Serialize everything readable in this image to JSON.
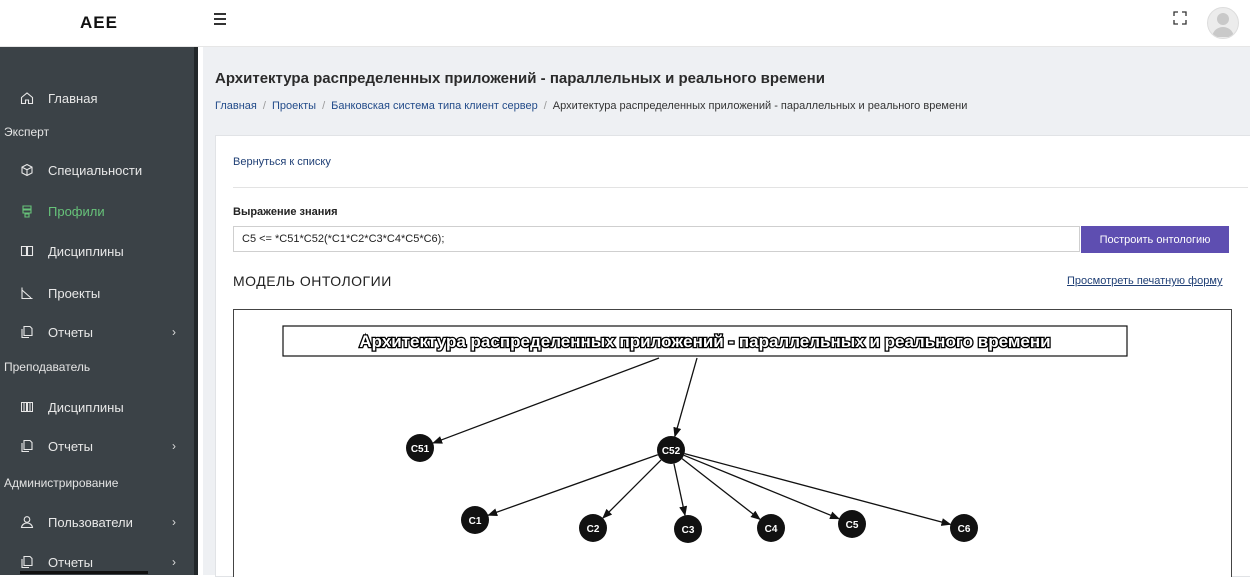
{
  "app": {
    "brand": "AEE"
  },
  "sidebar": {
    "items": [
      {
        "label": "Главная",
        "icon": "home-icon"
      },
      {
        "section": "Эксперт"
      },
      {
        "label": "Специальности",
        "icon": "cube-icon"
      },
      {
        "label": "Профили",
        "icon": "stack-icon",
        "active": true
      },
      {
        "label": "Дисциплины",
        "icon": "book-icon"
      },
      {
        "label": "Проекты",
        "icon": "chart-icon"
      },
      {
        "label": "Отчеты",
        "icon": "copy-icon",
        "chevron": "›"
      },
      {
        "section": "Преподаватель"
      },
      {
        "label": "Дисциплины",
        "icon": "book-icon"
      },
      {
        "label": "Отчеты",
        "icon": "copy-icon",
        "chevron": "›"
      },
      {
        "section": "Администрирование"
      },
      {
        "label": "Пользователи",
        "icon": "user-icon",
        "chevron": "›"
      },
      {
        "label": "Отчеты",
        "icon": "copy-icon",
        "chevron": "›"
      }
    ]
  },
  "page": {
    "title": "Архитектура распределенных приложений - параллельных и реального времени",
    "breadcrumb": [
      "Главная",
      "Проекты",
      "Банковская система типа клиент сервер",
      "Архитектура распределенных приложений - параллельных и реального времени"
    ]
  },
  "form": {
    "back_label": "Вернуться к списку",
    "expr_label": "Выражение знания",
    "expr_value": "C5 <= *C51*C52(*C1*C2*C3*C4*C5*C6);",
    "build_label": "Построить онтологию",
    "model_title": "МОДЕЛЬ ОНТОЛОГИИ",
    "print_label": "Просмотреть печатную форму"
  },
  "colors": {
    "accent": "#5e4eb1",
    "sidebar_bg": "#3b4247",
    "active": "#67c37a",
    "link": "#1f3f75"
  },
  "graph": {
    "root": "Архитектура распределенных приложений - параллельных и реального времени",
    "nodes": [
      "C51",
      "C52",
      "C1",
      "C2",
      "C3",
      "C4",
      "C5",
      "C6"
    ],
    "edges": [
      [
        "root",
        "C51"
      ],
      [
        "root",
        "C52"
      ],
      [
        "C52",
        "C1"
      ],
      [
        "C52",
        "C2"
      ],
      [
        "C52",
        "C3"
      ],
      [
        "C52",
        "C4"
      ],
      [
        "C52",
        "C5"
      ],
      [
        "C52",
        "C6"
      ]
    ]
  }
}
